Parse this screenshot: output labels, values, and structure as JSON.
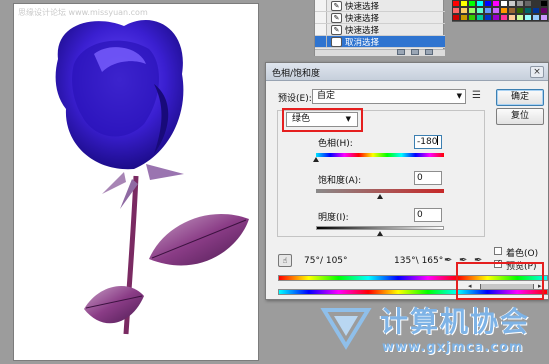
{
  "document": {
    "watermark": "思缘设计论坛 www.missyuan.com"
  },
  "history": {
    "items": [
      {
        "label": "快速选择",
        "selected": false
      },
      {
        "label": "快速选择",
        "selected": false
      },
      {
        "label": "快速选择",
        "selected": false
      },
      {
        "label": "取消选择",
        "selected": true
      }
    ]
  },
  "swatch_colors": [
    "#ff0000",
    "#ffff00",
    "#00ff00",
    "#00ffff",
    "#0000ff",
    "#ff00ff",
    "#ffffff",
    "#cccccc",
    "#999999",
    "#666666",
    "#333333",
    "#000000",
    "#ff6666",
    "#ffcc66",
    "#99ff66",
    "#66ffcc",
    "#6699ff",
    "#cc66ff",
    "#ff9900",
    "#996633",
    "#336600",
    "#006666",
    "#003399",
    "#660066",
    "#cc0000",
    "#cc9900",
    "#33cc00",
    "#00cc99",
    "#0033cc",
    "#9900cc",
    "#ff3399",
    "#ffcc99",
    "#ccff99",
    "#99ffff",
    "#99ccff",
    "#cc99ff"
  ],
  "dialog": {
    "title": "色相/饱和度",
    "close": "×",
    "preset_label": "预设(E):",
    "preset_value": "自定",
    "preset_menu_icon": "☰",
    "ok": "确定",
    "reset": "复位",
    "edit_value": "绿色",
    "hue_label": "色相(H):",
    "hue_value": "-180",
    "sat_label": "饱和度(A):",
    "sat_value": "0",
    "bri_label": "明度(I):",
    "bri_value": "0",
    "range_left": "75°/ 105°",
    "range_right": "135°\\ 165°",
    "colorize_label": "着色(O)",
    "colorize_checked": false,
    "preview_label": "预览(P)",
    "preview_checked": true,
    "hue_level": 0.0,
    "sat_level": 0.5,
    "bri_level": 0.5
  },
  "logo": {
    "title": "计算机协会",
    "url": "www.gxjmca.com"
  },
  "colors": {
    "highlight_blue": "#2f74d0",
    "annotation_red": "#e51f1f",
    "rose_blue": "#3a1fd0",
    "logo_blue": "#7eb3e6"
  }
}
